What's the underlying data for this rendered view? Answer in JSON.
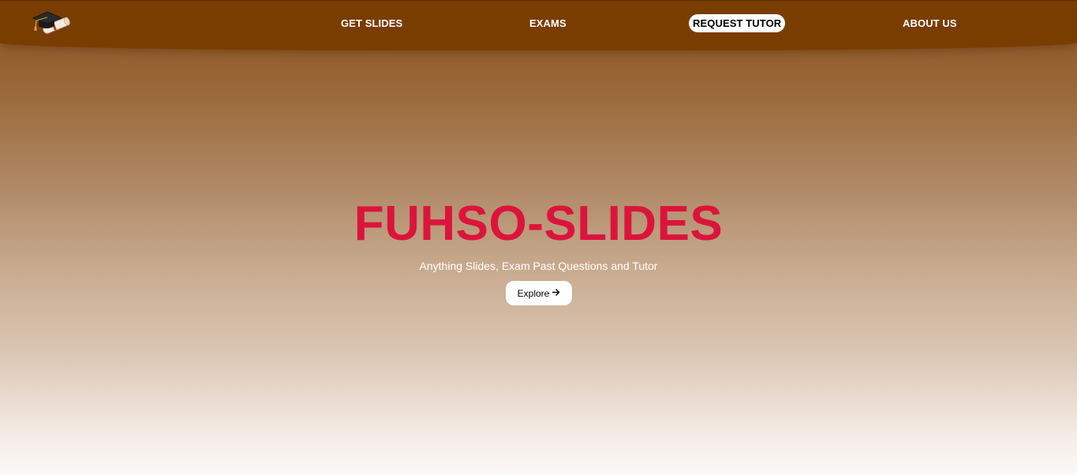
{
  "navbar": {
    "links": [
      {
        "label": "GET SLIDES"
      },
      {
        "label": "EXAMS"
      },
      {
        "label": "REQUEST TUTOR",
        "active": true
      },
      {
        "label": "ABOUT US"
      }
    ],
    "bg_color": "#7a3d00",
    "logo_icon": "graduation-cap-diploma-icon"
  },
  "hero": {
    "title": "FUHSO-SLIDES",
    "title_color": "#dc143c",
    "subtitle": "Anything Slides, Exam Past Questions and Tutor",
    "cta_label": "Explore",
    "cta_icon": "arrow-right-icon"
  }
}
